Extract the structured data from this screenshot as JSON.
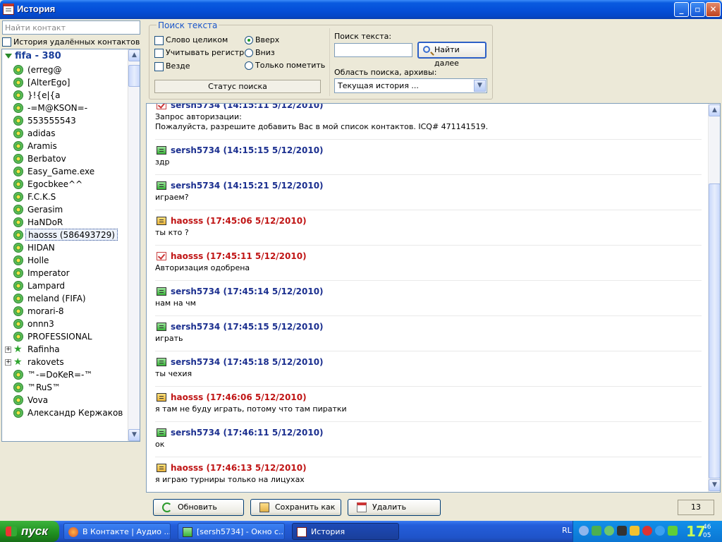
{
  "window": {
    "title": "История"
  },
  "left": {
    "search_placeholder": "Найти контакт",
    "show_deleted_label": "История удалённых контактов",
    "group": "fifa - 380",
    "contacts": [
      {
        "name": "(erreg@",
        "icon": "flower"
      },
      {
        "name": "[AlterEgo]",
        "icon": "flower"
      },
      {
        "name": "}!{e|{a",
        "icon": "flower"
      },
      {
        "name": "-=M@KSON=-",
        "icon": "flower"
      },
      {
        "name": "553555543",
        "icon": "flower"
      },
      {
        "name": "adidas",
        "icon": "flower"
      },
      {
        "name": "Aramis",
        "icon": "flower"
      },
      {
        "name": "Berbatov",
        "icon": "flower"
      },
      {
        "name": "Easy_Game.exe",
        "icon": "flower"
      },
      {
        "name": "Egocbkee^^",
        "icon": "flower"
      },
      {
        "name": "F.C.K.S",
        "icon": "flower"
      },
      {
        "name": "Gerasim",
        "icon": "flower"
      },
      {
        "name": "HaNDoR",
        "icon": "flower"
      },
      {
        "name": "haosss (586493729)",
        "icon": "flower",
        "selected": true
      },
      {
        "name": "HIDAN",
        "icon": "flower"
      },
      {
        "name": "Holle",
        "icon": "flower"
      },
      {
        "name": "Imperator",
        "icon": "flower"
      },
      {
        "name": "Lampard",
        "icon": "flower"
      },
      {
        "name": "meland (FIFA)",
        "icon": "flower"
      },
      {
        "name": "morari-8",
        "icon": "flower"
      },
      {
        "name": "onnn3",
        "icon": "flower"
      },
      {
        "name": "PROFESSIONAL",
        "icon": "flower"
      },
      {
        "name": "Rafinha",
        "icon": "star",
        "expandable": true
      },
      {
        "name": "rakovets",
        "icon": "star",
        "expandable": true
      },
      {
        "name": "™-=DoKeR=-™",
        "icon": "flower"
      },
      {
        "name": "™RuS™",
        "icon": "flower"
      },
      {
        "name": "Vova",
        "icon": "flower"
      },
      {
        "name": "Александр Кержаков",
        "icon": "flower"
      }
    ]
  },
  "search": {
    "title": "Поиск текста",
    "whole_word": "Слово целиком",
    "match_case": "Учитывать регистр",
    "everywhere": "Везде",
    "dir_up": "Вверх",
    "dir_down": "Вниз",
    "mark_only": "Только пометить",
    "status": "Статус поиска",
    "text_label": "Поиск текста:",
    "text_value": "",
    "find_next": "Найти далее",
    "area_label": "Область поиска, архивы:",
    "area_value": "Текущая история ..."
  },
  "messages": [
    {
      "author": "sersh5734",
      "time": "(14:15:11 5/12/2010)",
      "color": "blue",
      "icon": "auth",
      "lines": [
        "Запрос авторизации:",
        "Пожалуйста, разрешите добавить Вас в мой список контактов. ICQ# 471141519."
      ]
    },
    {
      "author": "sersh5734",
      "time": "(14:15:15 5/12/2010)",
      "color": "blue",
      "icon": "green",
      "lines": [
        "здр"
      ]
    },
    {
      "author": "sersh5734",
      "time": "(14:15:21 5/12/2010)",
      "color": "blue",
      "icon": "green",
      "lines": [
        "играем?"
      ]
    },
    {
      "author": "haosss",
      "time": "(17:45:06 5/12/2010)",
      "color": "red",
      "icon": "yellow",
      "lines": [
        "ты кто ?"
      ]
    },
    {
      "author": "haosss",
      "time": "(17:45:11 5/12/2010)",
      "color": "red",
      "icon": "auth",
      "lines": [
        "Авторизация одобрена"
      ]
    },
    {
      "author": "sersh5734",
      "time": "(17:45:14 5/12/2010)",
      "color": "blue",
      "icon": "green",
      "lines": [
        "нам на чм"
      ]
    },
    {
      "author": "sersh5734",
      "time": "(17:45:15 5/12/2010)",
      "color": "blue",
      "icon": "green",
      "lines": [
        "играть"
      ]
    },
    {
      "author": "sersh5734",
      "time": "(17:45:18 5/12/2010)",
      "color": "blue",
      "icon": "green",
      "lines": [
        "ты чехия"
      ]
    },
    {
      "author": "haosss",
      "time": "(17:46:06 5/12/2010)",
      "color": "red",
      "icon": "yellow",
      "lines": [
        "я там не буду играть, потому что там пиратки"
      ]
    },
    {
      "author": "sersh5734",
      "time": "(17:46:11 5/12/2010)",
      "color": "blue",
      "icon": "green",
      "lines": [
        "ок"
      ]
    },
    {
      "author": "haosss",
      "time": "(17:46:13 5/12/2010)",
      "color": "red",
      "icon": "yellow",
      "lines": [
        "я играю турниры только на лицухах"
      ]
    }
  ],
  "buttons": {
    "refresh": "Обновить",
    "save_as": "Сохранить как ...",
    "delete": "Удалить"
  },
  "count": "13",
  "taskbar": {
    "start": "пуск",
    "tasks": [
      "В Контакте | Аудио ...",
      "[sersh5734] - Окно с...",
      "История"
    ],
    "lang": "RL",
    "clock": "17",
    "clock_small_top": "46",
    "clock_small_bottom": "05"
  },
  "colors": {
    "author_blue": "#1b2f8f",
    "author_red": "#c01515",
    "title_bar": "#0550D9"
  }
}
